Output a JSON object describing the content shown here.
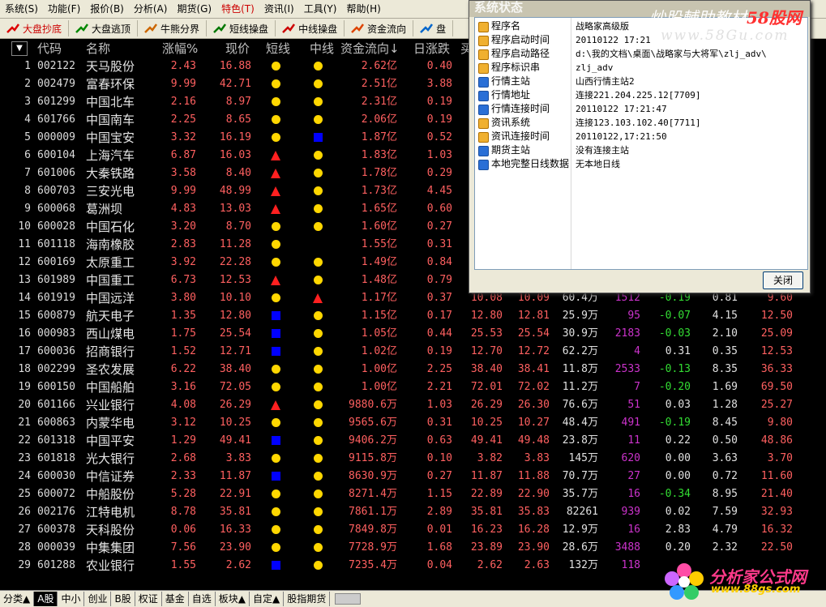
{
  "menu": [
    "系统(S)",
    "功能(F)",
    "报价(B)",
    "分析(A)",
    "期货(G)",
    "特色(T)",
    "资讯(I)",
    "工具(Y)",
    "帮助(H)"
  ],
  "menu_highlight_index": 5,
  "toolbar": [
    {
      "label": "大盘抄底",
      "icon": "red-arrow-icon"
    },
    {
      "label": "大盘逃顶",
      "icon": "green-arrow-icon"
    },
    {
      "label": "牛熊分界",
      "icon": "bull-bear-icon"
    },
    {
      "label": "短线操盘",
      "icon": "short-trade-icon"
    },
    {
      "label": "中线操盘",
      "icon": "mid-trade-icon"
    },
    {
      "label": "资金流向",
      "icon": "money-flow-icon"
    },
    {
      "label": "盘",
      "icon": "board-icon"
    }
  ],
  "headers": {
    "code": "代码",
    "name": "名称",
    "pct": "涨幅%",
    "price": "现价",
    "short": "短线",
    "mid": "中线",
    "flow": "资金流向↓",
    "day": "日涨跌",
    "extra": "买"
  },
  "rows": [
    {
      "i": "1",
      "code": "002122",
      "name": "天马股份",
      "pct": "2.43",
      "price": "16.88",
      "s1": "dot",
      "s2": "dot",
      "flow": "2.62亿",
      "day": "0.40"
    },
    {
      "i": "2",
      "code": "002479",
      "name": "富春环保",
      "pct": "9.99",
      "price": "42.71",
      "s1": "dot",
      "s2": "dot",
      "flow": "2.51亿",
      "day": "3.88"
    },
    {
      "i": "3",
      "code": "601299",
      "name": "中国北车",
      "pct": "2.16",
      "price": "8.97",
      "s1": "dot",
      "s2": "dot",
      "flow": "2.31亿",
      "day": "0.19"
    },
    {
      "i": "4",
      "code": "601766",
      "name": "中国南车",
      "pct": "2.25",
      "price": "8.65",
      "s1": "dot",
      "s2": "dot",
      "flow": "2.06亿",
      "day": "0.19"
    },
    {
      "i": "5",
      "code": "000009",
      "name": "中国宝安",
      "pct": "3.32",
      "price": "16.19",
      "s1": "dot",
      "s2": "sq",
      "flow": "1.87亿",
      "day": "0.52"
    },
    {
      "i": "6",
      "code": "600104",
      "name": "上海汽车",
      "pct": "6.87",
      "price": "16.03",
      "s1": "tri",
      "s2": "dot",
      "flow": "1.83亿",
      "day": "1.03"
    },
    {
      "i": "7",
      "code": "601006",
      "name": "大秦铁路",
      "pct": "3.58",
      "price": "8.40",
      "s1": "tri",
      "s2": "dot",
      "flow": "1.78亿",
      "day": "0.29"
    },
    {
      "i": "8",
      "code": "600703",
      "name": "三安光电",
      "pct": "9.99",
      "price": "48.99",
      "s1": "tri",
      "s2": "dot",
      "flow": "1.73亿",
      "day": "4.45"
    },
    {
      "i": "9",
      "code": "600068",
      "name": "葛洲坝",
      "pct": "4.83",
      "price": "13.03",
      "s1": "tri",
      "s2": "dot",
      "flow": "1.65亿",
      "day": "0.60"
    },
    {
      "i": "10",
      "code": "600028",
      "name": "中国石化",
      "pct": "3.20",
      "price": "8.70",
      "s1": "dot",
      "s2": "dot",
      "flow": "1.60亿",
      "day": "0.27"
    },
    {
      "i": "11",
      "code": "601118",
      "name": "海南橡胶",
      "pct": "2.83",
      "price": "11.28",
      "s1": "dot",
      "s2": "",
      "flow": "1.55亿",
      "day": "0.31"
    },
    {
      "i": "12",
      "code": "600169",
      "name": "太原重工",
      "pct": "3.92",
      "price": "22.28",
      "s1": "dot",
      "s2": "dot",
      "flow": "1.49亿",
      "day": "0.84"
    },
    {
      "i": "13",
      "code": "601989",
      "name": "中国重工",
      "pct": "6.73",
      "price": "12.53",
      "s1": "tri",
      "s2": "dot",
      "flow": "1.48亿",
      "day": "0.79"
    },
    {
      "i": "14",
      "code": "601919",
      "name": "中国远洋",
      "pct": "3.80",
      "price": "10.10",
      "s1": "dot",
      "s2": "tri",
      "flow": "1.17亿",
      "day": "0.37",
      "x1": "10.08",
      "x2": "10.09",
      "x3": "60.4万",
      "x4": "1512",
      "x5": "-0.19",
      "x6": "0.81",
      "x7": "9.60"
    },
    {
      "i": "15",
      "code": "600879",
      "name": "航天电子",
      "pct": "1.35",
      "price": "12.80",
      "s1": "sq",
      "s2": "dot",
      "flow": "1.15亿",
      "day": "0.17",
      "x1": "12.80",
      "x2": "12.81",
      "x3": "25.9万",
      "x4": "95",
      "x5": "-0.07",
      "x6": "4.15",
      "x7": "12.50"
    },
    {
      "i": "16",
      "code": "000983",
      "name": "西山煤电",
      "pct": "1.75",
      "price": "25.54",
      "s1": "sq",
      "s2": "dot",
      "flow": "1.05亿",
      "day": "0.44",
      "x1": "25.53",
      "x2": "25.54",
      "x3": "30.9万",
      "x4": "2183",
      "x5": "-0.03",
      "x6": "2.10",
      "x7": "25.09"
    },
    {
      "i": "17",
      "code": "600036",
      "name": "招商银行",
      "pct": "1.52",
      "price": "12.71",
      "s1": "sq",
      "s2": "dot",
      "flow": "1.02亿",
      "day": "0.19",
      "x1": "12.70",
      "x2": "12.72",
      "x3": "62.2万",
      "x4": "4",
      "x5": "0.31",
      "x6": "0.35",
      "x7": "12.53"
    },
    {
      "i": "18",
      "code": "002299",
      "name": "圣农发展",
      "pct": "6.22",
      "price": "38.40",
      "s1": "dot",
      "s2": "dot",
      "flow": "1.00亿",
      "day": "2.25",
      "x1": "38.40",
      "x2": "38.41",
      "x3": "11.8万",
      "x4": "2533",
      "x5": "-0.13",
      "x6": "8.35",
      "x7": "36.33"
    },
    {
      "i": "19",
      "code": "600150",
      "name": "中国船舶",
      "pct": "3.16",
      "price": "72.05",
      "s1": "dot",
      "s2": "dot",
      "flow": "1.00亿",
      "day": "2.21",
      "x1": "72.01",
      "x2": "72.02",
      "x3": "11.2万",
      "x4": "7",
      "x5": "-0.20",
      "x6": "1.69",
      "x7": "69.50"
    },
    {
      "i": "20",
      "code": "601166",
      "name": "兴业银行",
      "pct": "4.08",
      "price": "26.29",
      "s1": "tri",
      "s2": "dot",
      "flow": "9880.6万",
      "day": "1.03",
      "x1": "26.29",
      "x2": "26.30",
      "x3": "76.6万",
      "x4": "51",
      "x5": "0.03",
      "x6": "1.28",
      "x7": "25.27"
    },
    {
      "i": "21",
      "code": "600863",
      "name": "内蒙华电",
      "pct": "3.12",
      "price": "10.25",
      "s1": "dot",
      "s2": "dot",
      "flow": "9565.6万",
      "day": "0.31",
      "x1": "10.25",
      "x2": "10.27",
      "x3": "48.4万",
      "x4": "491",
      "x5": "-0.19",
      "x6": "8.45",
      "x7": "9.80"
    },
    {
      "i": "22",
      "code": "601318",
      "name": "中国平安",
      "pct": "1.29",
      "price": "49.41",
      "s1": "sq",
      "s2": "dot",
      "flow": "9406.2万",
      "day": "0.63",
      "x1": "49.41",
      "x2": "49.48",
      "x3": "23.8万",
      "x4": "11",
      "x5": "0.22",
      "x6": "0.50",
      "x7": "48.86"
    },
    {
      "i": "23",
      "code": "601818",
      "name": "光大银行",
      "pct": "2.68",
      "price": "3.83",
      "s1": "dot",
      "s2": "dot",
      "flow": "9115.8万",
      "day": "0.10",
      "x1": "3.82",
      "x2": "3.83",
      "x3": "145万",
      "x4": "620",
      "x5": "0.00",
      "x6": "3.63",
      "x7": "3.70"
    },
    {
      "i": "24",
      "code": "600030",
      "name": "中信证券",
      "pct": "2.33",
      "price": "11.87",
      "s1": "sq",
      "s2": "dot",
      "flow": "8630.9万",
      "day": "0.27",
      "x1": "11.87",
      "x2": "11.88",
      "x3": "70.7万",
      "x4": "27",
      "x5": "0.00",
      "x6": "0.72",
      "x7": "11.60"
    },
    {
      "i": "25",
      "code": "600072",
      "name": "中船股份",
      "pct": "5.28",
      "price": "22.91",
      "s1": "dot",
      "s2": "dot",
      "flow": "8271.4万",
      "day": "1.15",
      "x1": "22.89",
      "x2": "22.90",
      "x3": "35.7万",
      "x4": "16",
      "x5": "-0.34",
      "x6": "8.95",
      "x7": "21.40"
    },
    {
      "i": "26",
      "code": "002176",
      "name": "江特电机",
      "pct": "8.78",
      "price": "35.81",
      "s1": "dot",
      "s2": "dot",
      "flow": "7861.1万",
      "day": "2.89",
      "x1": "35.81",
      "x2": "35.83",
      "x3": "82261",
      "x4": "939",
      "x5": "0.02",
      "x6": "7.59",
      "x7": "32.93"
    },
    {
      "i": "27",
      "code": "600378",
      "name": "天科股份",
      "pct": "0.06",
      "price": "16.33",
      "s1": "dot",
      "s2": "dot",
      "flow": "7849.8万",
      "day": "0.01",
      "x1": "16.23",
      "x2": "16.28",
      "x3": "12.9万",
      "x4": "16",
      "x5": "2.83",
      "x6": "4.79",
      "x7": "16.32"
    },
    {
      "i": "28",
      "code": "000039",
      "name": "中集集团",
      "pct": "7.56",
      "price": "23.90",
      "s1": "dot",
      "s2": "dot",
      "flow": "7728.9万",
      "day": "1.68",
      "x1": "23.89",
      "x2": "23.90",
      "x3": "28.6万",
      "x4": "3488",
      "x5": "0.20",
      "x6": "2.32",
      "x7": "22.50"
    },
    {
      "i": "29",
      "code": "601288",
      "name": "农业银行",
      "pct": "1.55",
      "price": "2.62",
      "s1": "sq",
      "s2": "dot",
      "flow": "7235.4万",
      "day": "0.04",
      "x1": "2.62",
      "x2": "2.63",
      "x3": "132万",
      "x4": "118",
      "x5": "",
      "x6": "",
      "x7": ""
    }
  ],
  "tabs": [
    "分类▲",
    "A股",
    "中小",
    "创业",
    "B股",
    "权证",
    "基金",
    "自选",
    "板块▲",
    "自定▲",
    "股指期货"
  ],
  "active_tab_index": 1,
  "dialog": {
    "title": "系统状态",
    "items": [
      {
        "k": "程序名",
        "v": "战略家高级版",
        "type": "folder"
      },
      {
        "k": "程序启动时间",
        "v": "20110122 17:21",
        "type": "folder"
      },
      {
        "k": "程序启动路径",
        "v": "d:\\我的文档\\桌面\\战略家与大将军\\zlj_adv\\",
        "type": "folder"
      },
      {
        "k": "程序标识串",
        "v": "zlj_adv",
        "type": "folder"
      },
      {
        "k": "行情主站",
        "v": "山西行情主站2",
        "type": "info"
      },
      {
        "k": "行情地址",
        "v": "连接221.204.225.12[7709]",
        "type": "info"
      },
      {
        "k": "行情连接时间",
        "v": "20110122 17:21:47",
        "type": "info"
      },
      {
        "k": "资讯系统",
        "v": "连接123.103.102.40[7711]",
        "type": "folder"
      },
      {
        "k": "资讯连接时间",
        "v": "20110122,17:21:50",
        "type": "folder"
      },
      {
        "k": "期货主站",
        "v": "没有连接主站",
        "type": "info"
      },
      {
        "k": "本地完整日线数据",
        "v": "无本地日线",
        "type": "info"
      }
    ],
    "close_label": "关闭"
  },
  "watermark_top": {
    "line1_a": "炒股輔助教材",
    "line1_b": "58股网",
    "line2": "www.58Gu.com"
  },
  "watermark_bottom": {
    "line1": "分析家公式网",
    "line2": "www.88gs.com"
  },
  "colors": {
    "up": "#ff6060",
    "dot": "#ffd700",
    "tri": "#ff2020",
    "sq": "#0000ff",
    "vol": "#cc33cc"
  }
}
